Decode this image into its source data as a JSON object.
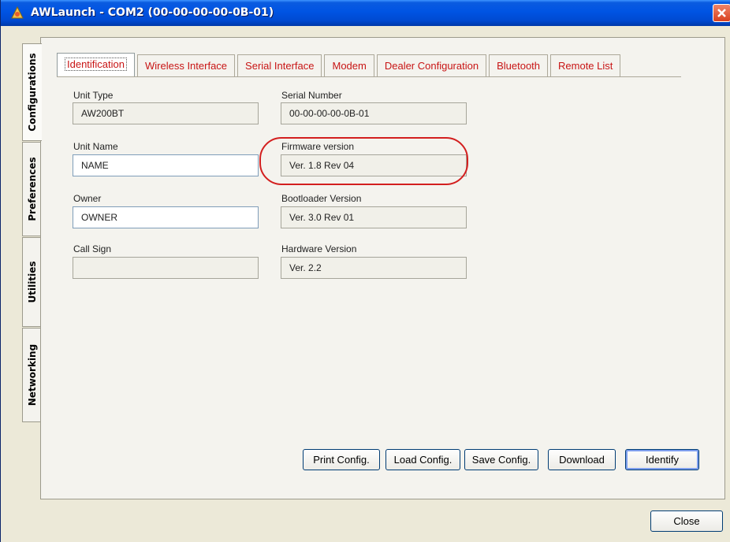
{
  "window": {
    "title": "AWLaunch - COM2  (00-00-00-00-0B-01)"
  },
  "side_tabs": [
    {
      "label": "Configurations",
      "active": true
    },
    {
      "label": "Preferences",
      "active": false
    },
    {
      "label": "Utilities",
      "active": false
    },
    {
      "label": "Networking",
      "active": false
    }
  ],
  "tabs": [
    {
      "label": "Identification",
      "active": true
    },
    {
      "label": "Wireless Interface",
      "active": false
    },
    {
      "label": "Serial Interface",
      "active": false
    },
    {
      "label": "Modem",
      "active": false
    },
    {
      "label": "Dealer Configuration",
      "active": false
    },
    {
      "label": "Bluetooth",
      "active": false
    },
    {
      "label": "Remote List",
      "active": false
    }
  ],
  "fields": {
    "unit_type": {
      "label": "Unit Type",
      "value": "AW200BT"
    },
    "unit_name": {
      "label": "Unit Name",
      "value": "NAME"
    },
    "owner": {
      "label": "Owner",
      "value": "OWNER"
    },
    "call_sign": {
      "label": "Call Sign",
      "value": ""
    },
    "serial_number": {
      "label": "Serial Number",
      "value": "00-00-00-00-0B-01"
    },
    "firmware_version": {
      "label": "Firmware version",
      "value": "Ver. 1.8 Rev 04"
    },
    "bootloader_version": {
      "label": "Bootloader Version",
      "value": "Ver. 3.0 Rev 01"
    },
    "hardware_version": {
      "label": "Hardware Version",
      "value": "Ver. 2.2"
    }
  },
  "buttons": {
    "print_config": "Print Config.",
    "load_config": "Load Config.",
    "save_config": "Save Config.",
    "download": "Download",
    "identify": "Identify",
    "close": "Close"
  },
  "colors": {
    "tab_text": "#c81515",
    "highlight_ring": "#d31f1f",
    "titlebar": "#0054e3"
  }
}
